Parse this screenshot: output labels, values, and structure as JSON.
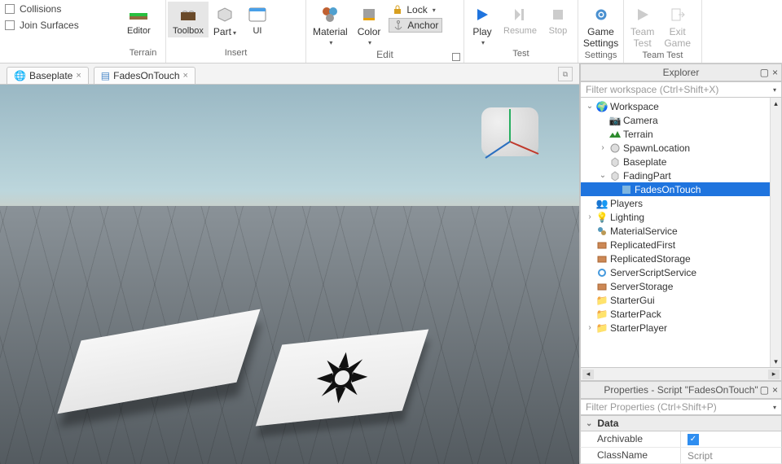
{
  "ribbon": {
    "checks": {
      "collisions": "Collisions",
      "join": "Join Surfaces"
    },
    "editor": "Editor",
    "toolbox": "Toolbox",
    "part": "Part",
    "ui": "UI",
    "material": "Material",
    "color": "Color",
    "lock": "Lock",
    "anchor": "Anchor",
    "play": "Play",
    "resume": "Resume",
    "stop": "Stop",
    "game_settings_l1": "Game",
    "game_settings_l2": "Settings",
    "team_test_l1": "Team",
    "team_test_l2": "Test",
    "exit_game_l1": "Exit",
    "exit_game_l2": "Game",
    "groups": {
      "terrain": "Terrain",
      "insert": "Insert",
      "edit": "Edit",
      "test": "Test",
      "settings": "Settings",
      "team_test": "Team Test"
    }
  },
  "tabs": {
    "baseplate": "Baseplate",
    "script": "FadesOnTouch"
  },
  "explorer": {
    "title": "Explorer",
    "filter_placeholder": "Filter workspace (Ctrl+Shift+X)",
    "items": {
      "workspace": "Workspace",
      "camera": "Camera",
      "terrain": "Terrain",
      "spawn": "SpawnLocation",
      "baseplate": "Baseplate",
      "fadingpart": "FadingPart",
      "fadesontouch": "FadesOnTouch",
      "players": "Players",
      "lighting": "Lighting",
      "materialservice": "MaterialService",
      "repfirst": "ReplicatedFirst",
      "repstorage": "ReplicatedStorage",
      "sss": "ServerScriptService",
      "serverstorage": "ServerStorage",
      "startergui": "StarterGui",
      "starterpack": "StarterPack",
      "starterplayer": "StarterPlayer"
    }
  },
  "properties": {
    "title": "Properties - Script \"FadesOnTouch\"",
    "filter_placeholder": "Filter Properties (Ctrl+Shift+P)",
    "section": "Data",
    "rows": {
      "archivable": {
        "name": "Archivable",
        "value": true
      },
      "classname": {
        "name": "ClassName",
        "value": "Script"
      }
    }
  }
}
